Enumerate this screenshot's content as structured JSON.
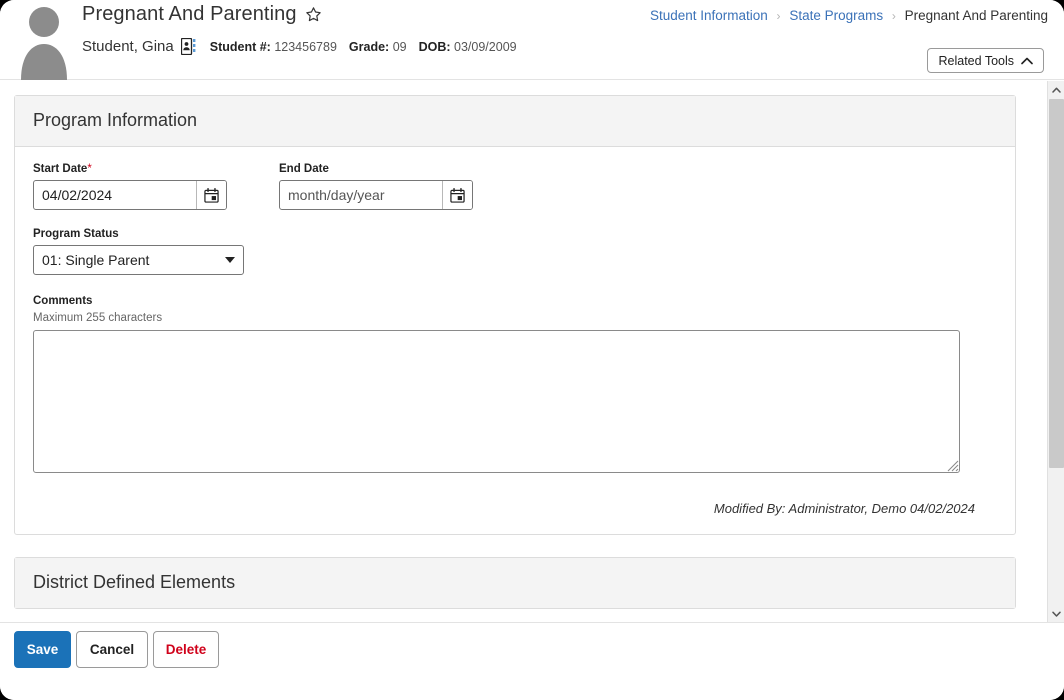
{
  "header": {
    "avatar_icon": "person-avatar-icon",
    "title": "Pregnant And Parenting",
    "favorite_icon": "star-outline-icon",
    "student_name": "Student, Gina",
    "student_card_icon": "id-card-icon",
    "meta": [
      {
        "label": "Student #:",
        "value": "123456789"
      },
      {
        "label": "Grade:",
        "value": "09"
      },
      {
        "label": "DOB:",
        "value": "03/09/2009"
      }
    ],
    "breadcrumb": {
      "items": [
        "Student Information",
        "State Programs"
      ],
      "current": "Pregnant And Parenting",
      "separator": "›"
    },
    "related_tools": {
      "label": "Related Tools",
      "icon": "chevron-up-icon"
    }
  },
  "program_information": {
    "section_title": "Program Information",
    "start_date": {
      "label": "Start Date",
      "required_marker": "*",
      "value": "04/02/2024",
      "placeholder": "month/day/year",
      "calendar_icon": "calendar-icon"
    },
    "end_date": {
      "label": "End Date",
      "value": "",
      "placeholder": "month/day/year",
      "calendar_icon": "calendar-icon"
    },
    "program_status": {
      "label": "Program Status",
      "selected": "01: Single Parent",
      "options": [
        "01: Single Parent"
      ],
      "icon": "chevron-down-icon"
    },
    "comments": {
      "label": "Comments",
      "hint": "Maximum 255 characters",
      "value": "",
      "placeholder": "",
      "resize_icon": "resize-grip-icon"
    },
    "modified_by": "Modified By: Administrator, Demo 04/02/2024"
  },
  "district_defined_elements": {
    "section_title": "District Defined Elements"
  },
  "footer": {
    "save_label": "Save",
    "cancel_label": "Cancel",
    "delete_label": "Delete"
  },
  "scrollbar": {
    "up_icon": "chevron-up-icon",
    "down_icon": "chevron-down-icon"
  },
  "colors": {
    "accent_blue": "#1b72b8",
    "link_blue": "#3b72b8",
    "danger_red": "#d0021b",
    "panel_gray": "#f4f4f4",
    "border_gray": "#dcdcdc"
  }
}
